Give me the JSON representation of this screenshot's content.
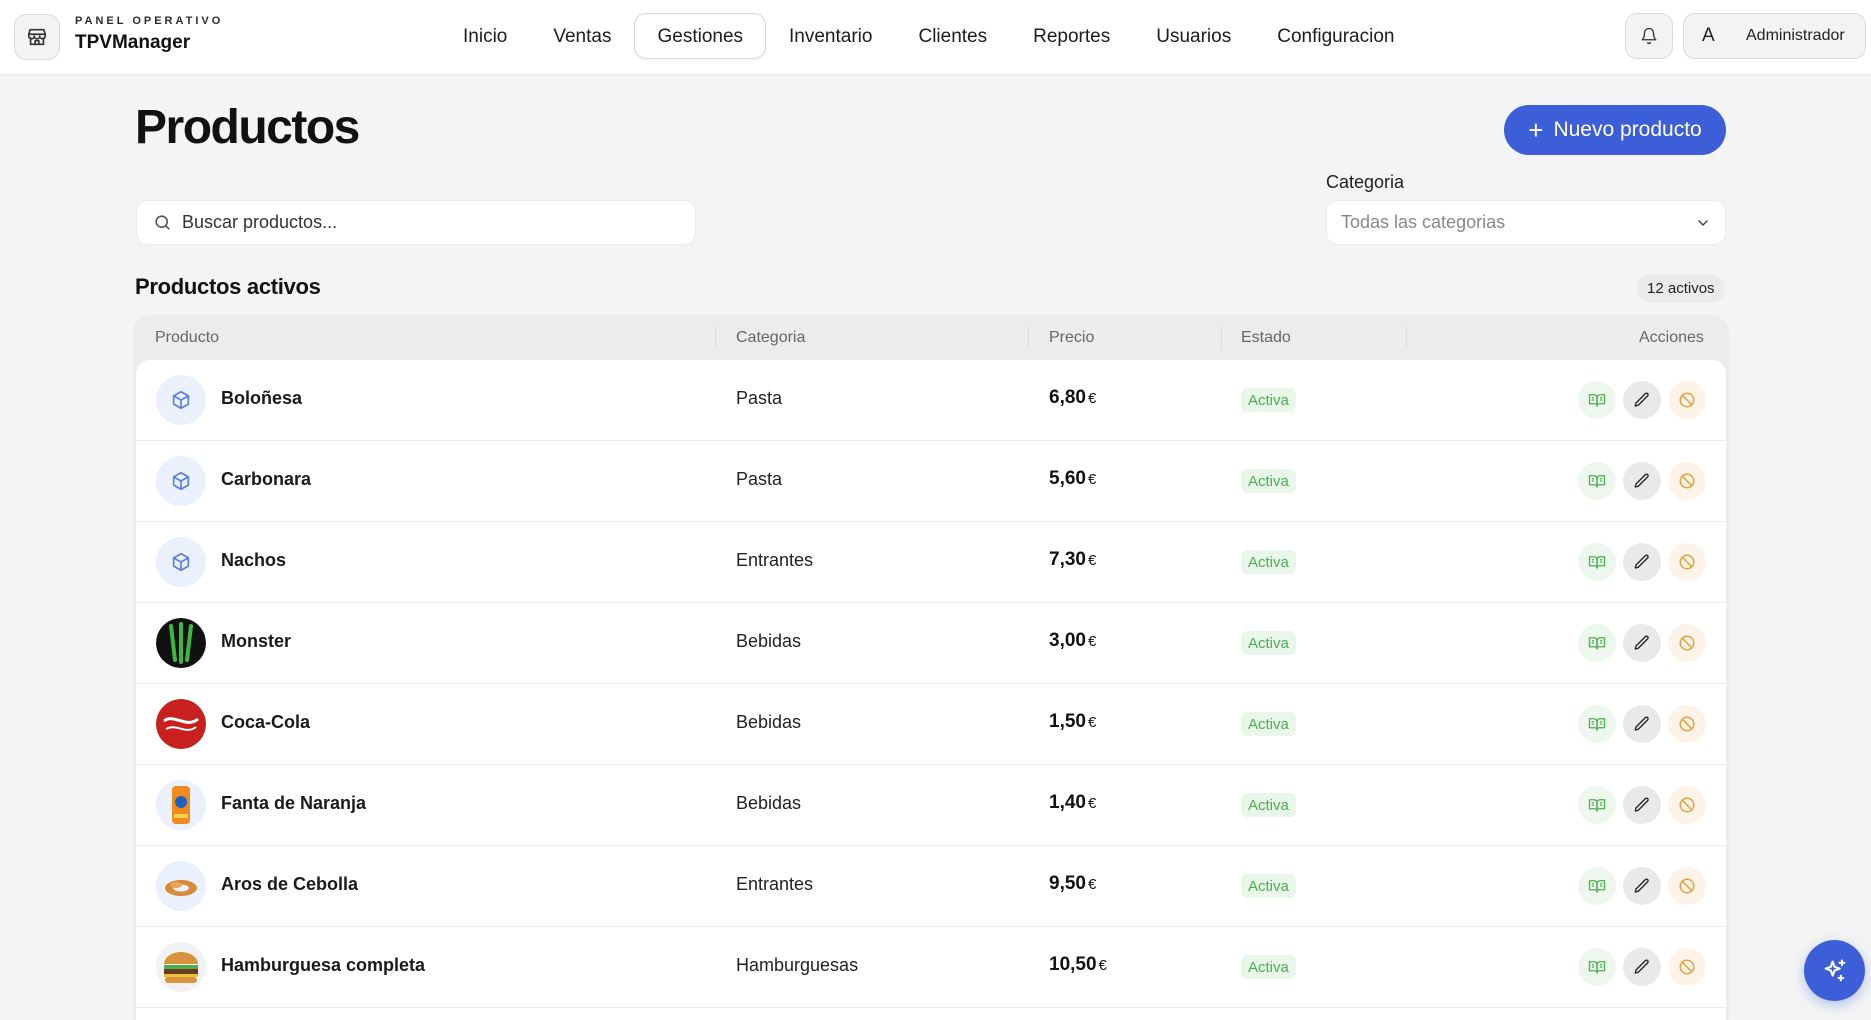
{
  "brand": {
    "kicker": "PANEL OPERATIVO",
    "name": "TPVManager"
  },
  "nav": [
    {
      "label": "Inicio",
      "active": false
    },
    {
      "label": "Ventas",
      "active": false
    },
    {
      "label": "Gestiones",
      "active": true
    },
    {
      "label": "Inventario",
      "active": false
    },
    {
      "label": "Clientes",
      "active": false
    },
    {
      "label": "Reportes",
      "active": false
    },
    {
      "label": "Usuarios",
      "active": false
    },
    {
      "label": "Configuracion",
      "active": false
    }
  ],
  "user": {
    "initial": "A",
    "name": "Administrador"
  },
  "page": {
    "title": "Productos",
    "new_button": "Nuevo producto",
    "search_placeholder": "Buscar productos...",
    "category_label": "Categoria",
    "category_value": "Todas las categorias",
    "section_title": "Productos activos",
    "count_badge": "12 activos"
  },
  "table": {
    "headers": {
      "product": "Producto",
      "category": "Categoria",
      "price": "Precio",
      "status": "Estado",
      "actions": "Acciones"
    },
    "rows": [
      {
        "name": "Boloñesa",
        "category": "Pasta",
        "price": "6,80",
        "currency": "€",
        "status": "Activa",
        "thumb": "box-icon"
      },
      {
        "name": "Carbonara",
        "category": "Pasta",
        "price": "5,60",
        "currency": "€",
        "status": "Activa",
        "thumb": "box-icon"
      },
      {
        "name": "Nachos",
        "category": "Entrantes",
        "price": "7,30",
        "currency": "€",
        "status": "Activa",
        "thumb": "box-icon"
      },
      {
        "name": "Monster",
        "category": "Bebidas",
        "price": "3,00",
        "currency": "€",
        "status": "Activa",
        "thumb": "monster-can-image"
      },
      {
        "name": "Coca-Cola",
        "category": "Bebidas",
        "price": "1,50",
        "currency": "€",
        "status": "Activa",
        "thumb": "cola-can-image"
      },
      {
        "name": "Fanta de Naranja",
        "category": "Bebidas",
        "price": "1,40",
        "currency": "€",
        "status": "Activa",
        "thumb": "fanta-can-image"
      },
      {
        "name": "Aros de Cebolla",
        "category": "Entrantes",
        "price": "9,50",
        "currency": "€",
        "status": "Activa",
        "thumb": "onion-rings-image"
      },
      {
        "name": "Hamburguesa completa",
        "category": "Hamburguesas",
        "price": "10,50",
        "currency": "€",
        "status": "Activa",
        "thumb": "burger-image"
      }
    ]
  },
  "colors": {
    "accent": "#3c5fd9",
    "status_green": "#4caf50",
    "warn_orange": "#e8a13c"
  }
}
